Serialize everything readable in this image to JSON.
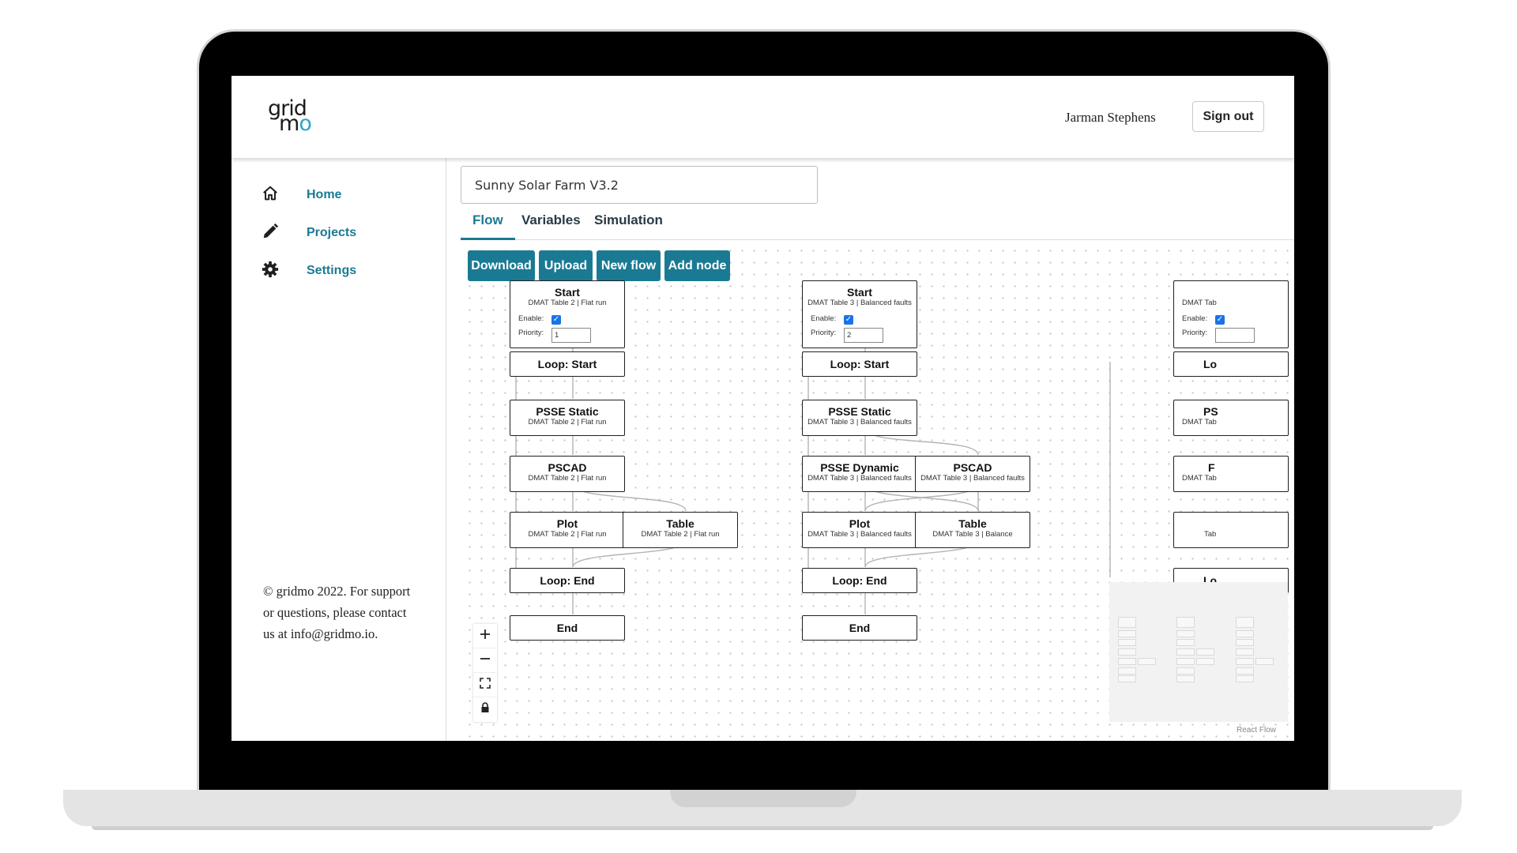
{
  "header": {
    "logo_top": "grid",
    "logo_bottom": "mo",
    "user_name": "Jarman Stephens",
    "signout_label": "Sign out"
  },
  "sidebar": {
    "items": [
      {
        "label": "Home",
        "icon": "home-icon"
      },
      {
        "label": "Projects",
        "icon": "pencil-icon"
      },
      {
        "label": "Settings",
        "icon": "gear-icon"
      }
    ],
    "footer": "© gridmo 2022. For support or questions, please contact us at info@gridmo.io."
  },
  "project": {
    "name": "Sunny Solar Farm V3.2"
  },
  "tabs": [
    {
      "label": "Flow",
      "active": true
    },
    {
      "label": "Variables",
      "active": false
    },
    {
      "label": "Simulation",
      "active": false
    }
  ],
  "toolbar": {
    "download": "Download",
    "upload": "Upload",
    "new_flow": "New flow",
    "add_node": "Add node"
  },
  "colors": {
    "accent": "#1b7a93",
    "checkbox": "#1a73e8",
    "logo_accent": "#29a6c9"
  },
  "flows": [
    {
      "start": {
        "title": "Start",
        "subtitle": "DMAT Table 2 | Flat run",
        "enable_label": "Enable:",
        "enabled": true,
        "priority_label": "Priority:",
        "priority": "1"
      },
      "loop_start": "Loop: Start",
      "psse_static": {
        "title": "PSSE Static",
        "subtitle": "DMAT Table 2 | Flat run"
      },
      "pscad": {
        "title": "PSCAD",
        "subtitle": "DMAT Table 2 | Flat run"
      },
      "plot": {
        "title": "Plot",
        "subtitle": "DMAT Table 2 | Flat run"
      },
      "table": {
        "title": "Table",
        "subtitle": "DMAT Table 2 | Flat run"
      },
      "loop_end": "Loop: End",
      "end": "End"
    },
    {
      "start": {
        "title": "Start",
        "subtitle": "DMAT Table 3 | Balanced faults",
        "enable_label": "Enable:",
        "enabled": true,
        "priority_label": "Priority:",
        "priority": "2"
      },
      "loop_start": "Loop: Start",
      "psse_static": {
        "title": "PSSE Static",
        "subtitle": "DMAT Table 3 | Balanced faults"
      },
      "psse_dynamic": {
        "title": "PSSE Dynamic",
        "subtitle": "DMAT Table 3 | Balanced faults"
      },
      "pscad": {
        "title": "PSCAD",
        "subtitle": "DMAT Table 3 | Balanced faults"
      },
      "plot": {
        "title": "Plot",
        "subtitle": "DMAT Table 3 | Balanced faults"
      },
      "table": {
        "title": "Table",
        "subtitle": "DMAT Table 3 | Balance"
      },
      "loop_end": "Loop: End",
      "end": "End"
    },
    {
      "start_subtitle": "DMAT Tab",
      "enable_label": "Enable:",
      "priority_label": "Priority:",
      "loop_start": "Lo",
      "psse_static": {
        "title": "PS",
        "subtitle": "DMAT Tab"
      },
      "pscad": {
        "title": "F",
        "subtitle": "DMAT Tab"
      },
      "plot_subtitle": "Tab",
      "loop_end": "Lo"
    }
  ],
  "canvas_controls": [
    {
      "name": "zoom-in",
      "icon": "plus-icon"
    },
    {
      "name": "zoom-out",
      "icon": "minus-icon"
    },
    {
      "name": "fit-view",
      "icon": "fit-view-icon"
    },
    {
      "name": "lock",
      "icon": "lock-icon"
    }
  ],
  "attribution": "React Flow"
}
